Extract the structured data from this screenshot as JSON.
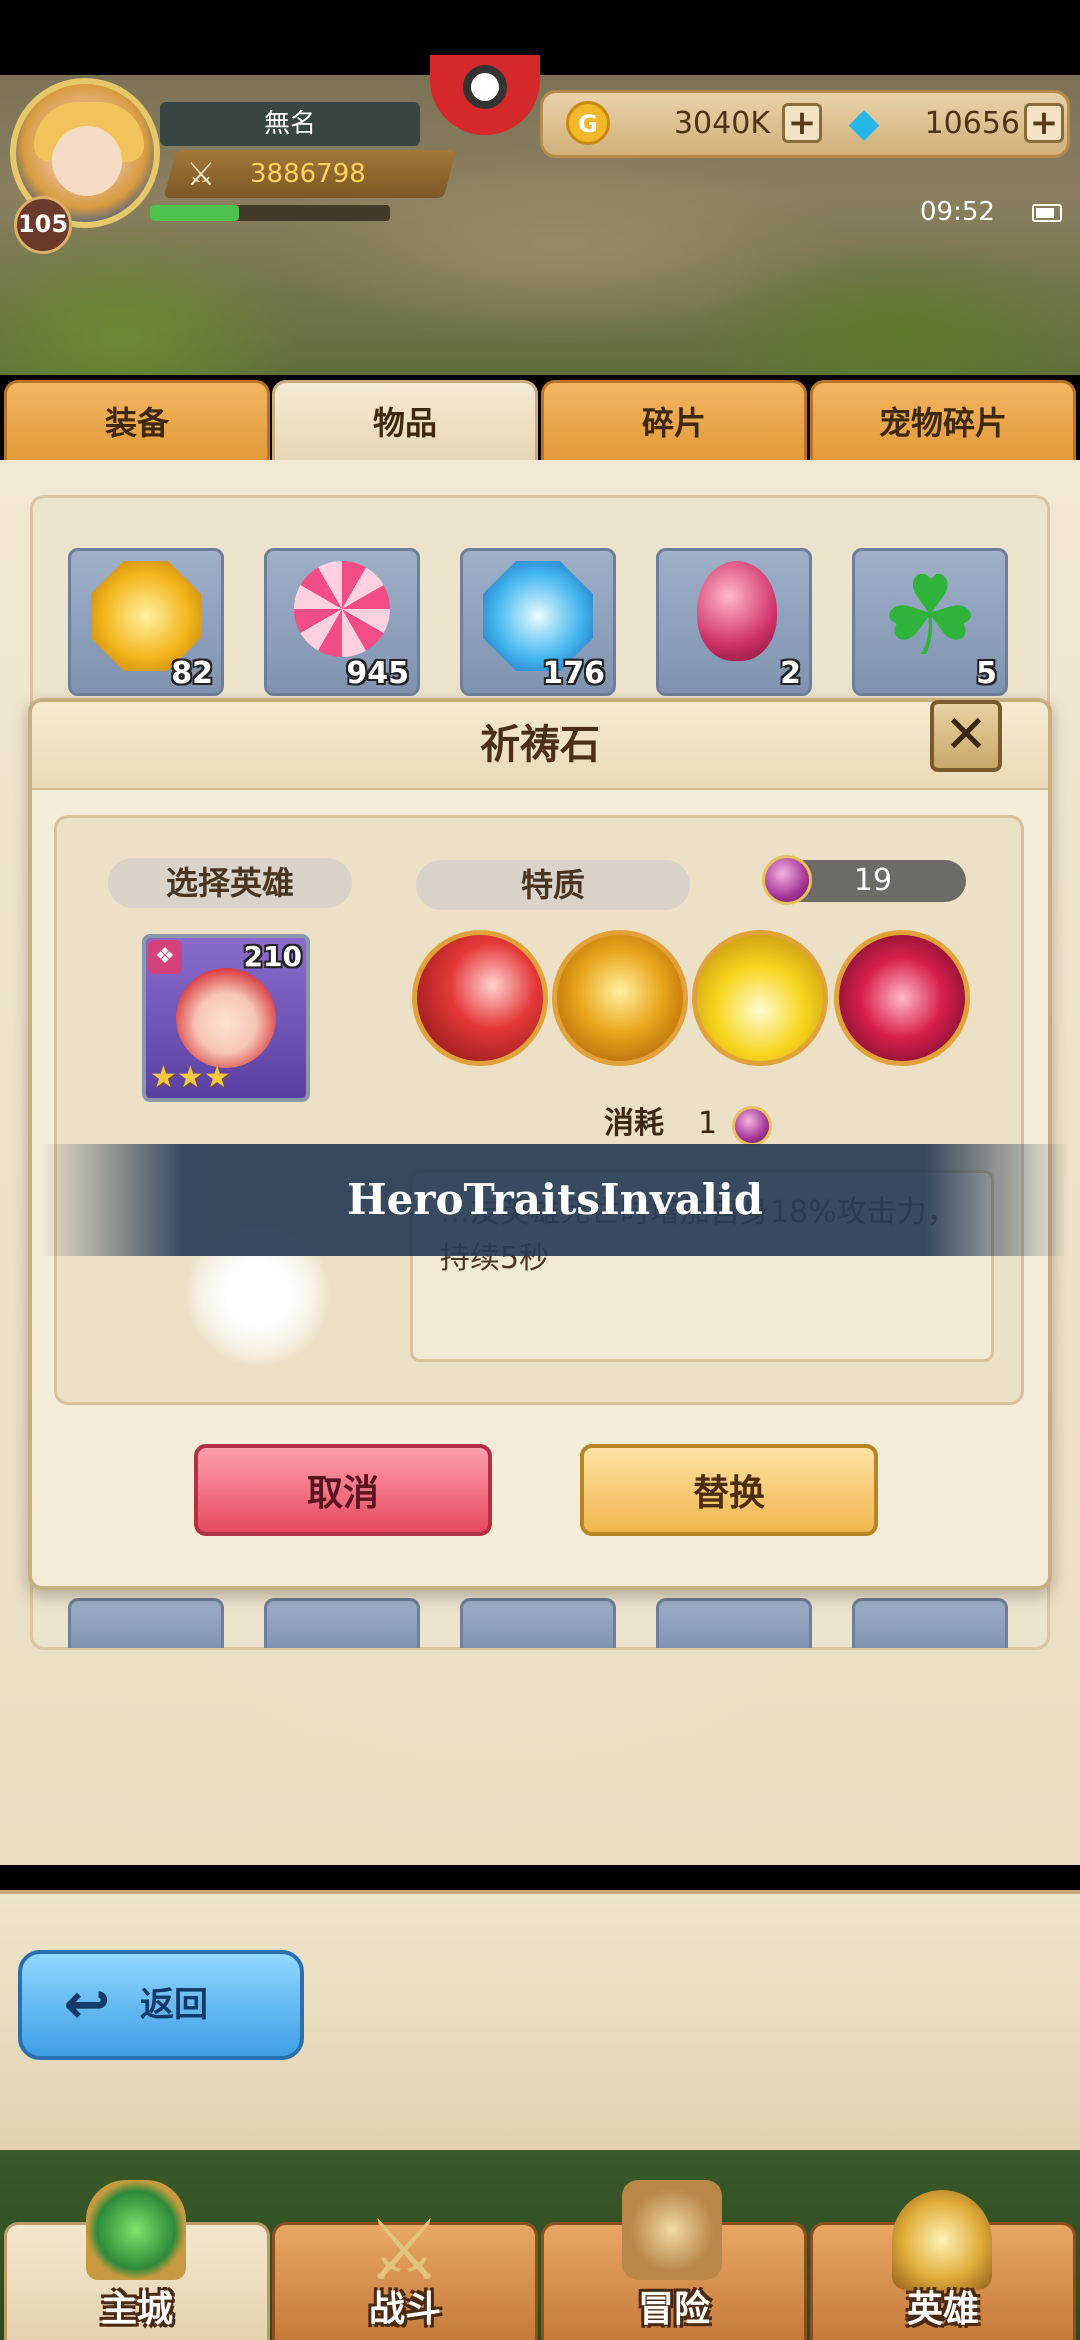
{
  "player": {
    "name": "無名",
    "level": "105",
    "power": "3886798",
    "exp_fraction": 0.37
  },
  "currency": {
    "gold": "3040K",
    "gems": "10656",
    "plus": "+"
  },
  "status": {
    "time": "09:52"
  },
  "tabs": [
    "装备",
    "物品",
    "碎片",
    "宠物碎片"
  ],
  "active_tab": "物品",
  "inventory": {
    "row1": [
      {
        "icon": "yellow-gem-icon",
        "count": "82"
      },
      {
        "icon": "lollipop-icon",
        "count": "945"
      },
      {
        "icon": "blue-crystal-icon",
        "count": "176"
      },
      {
        "icon": "egg-icon",
        "count": "2"
      },
      {
        "icon": "clover-icon",
        "count": "5"
      }
    ]
  },
  "modal": {
    "title": "祈祷石",
    "close": "✕",
    "select_hero": "选择英雄",
    "trait": "特质",
    "stone_count": "19",
    "hero": {
      "level": "210",
      "stars": "★★★"
    },
    "cost_label": "消耗",
    "cost_value": "1",
    "description": "…友英雄死亡时增加自身18%攻击力，持续5秒",
    "cancel": "取消",
    "replace": "替换"
  },
  "toast": {
    "message": "HeroTraitsInvalid"
  },
  "back": {
    "label": "返回"
  },
  "nav": {
    "city": "主城",
    "battle": "战斗",
    "adventure": "冒险",
    "heroes": "英雄"
  },
  "colors": {
    "tab_active": "#ece0c7",
    "tab_inactive": "#eba24a",
    "cancel": "#e6495f",
    "replace": "#f0b64e",
    "toast_bg": "#28405a"
  }
}
